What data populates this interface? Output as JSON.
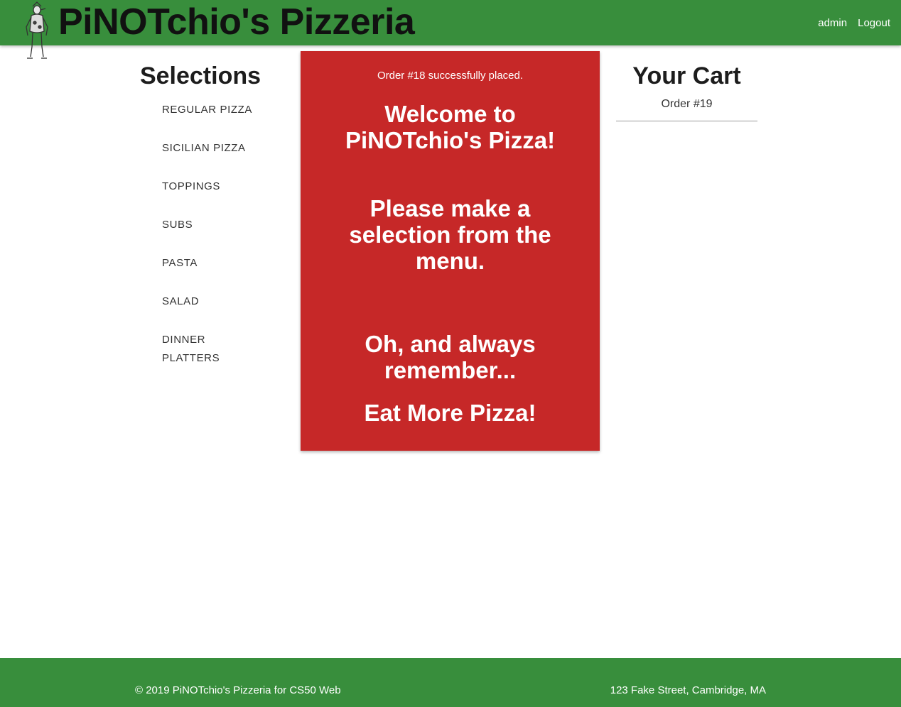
{
  "header": {
    "brand": "PiNOTchio's Pizzeria",
    "logo_icon": "pinocchio-figure-icon",
    "nav_links": [
      "admin",
      "Logout"
    ]
  },
  "selections": {
    "title": "Selections",
    "items": [
      "REGULAR PIZZA",
      "SICILIAN PIZZA",
      "TOPPINGS",
      "SUBS",
      "PASTA",
      "SALAD",
      "DINNER PLATTERS"
    ]
  },
  "main": {
    "flash": "Order #18 successfully placed.",
    "welcome": "Welcome to PiNOTchio's Pizza!",
    "prompt": "Please make a selection from the menu.",
    "remember": "Oh, and always remember...",
    "tagline": "Eat More Pizza!"
  },
  "cart": {
    "title": "Your Cart",
    "order": "Order #19"
  },
  "footer": {
    "copyright": "© 2019 PiNOTchio's Pizzeria for CS50 Web",
    "address": "123 Fake Street, Cambridge, MA"
  },
  "colors": {
    "nav_green": "#388e3c",
    "card_red": "#c62828",
    "brand_text": "#111111"
  }
}
